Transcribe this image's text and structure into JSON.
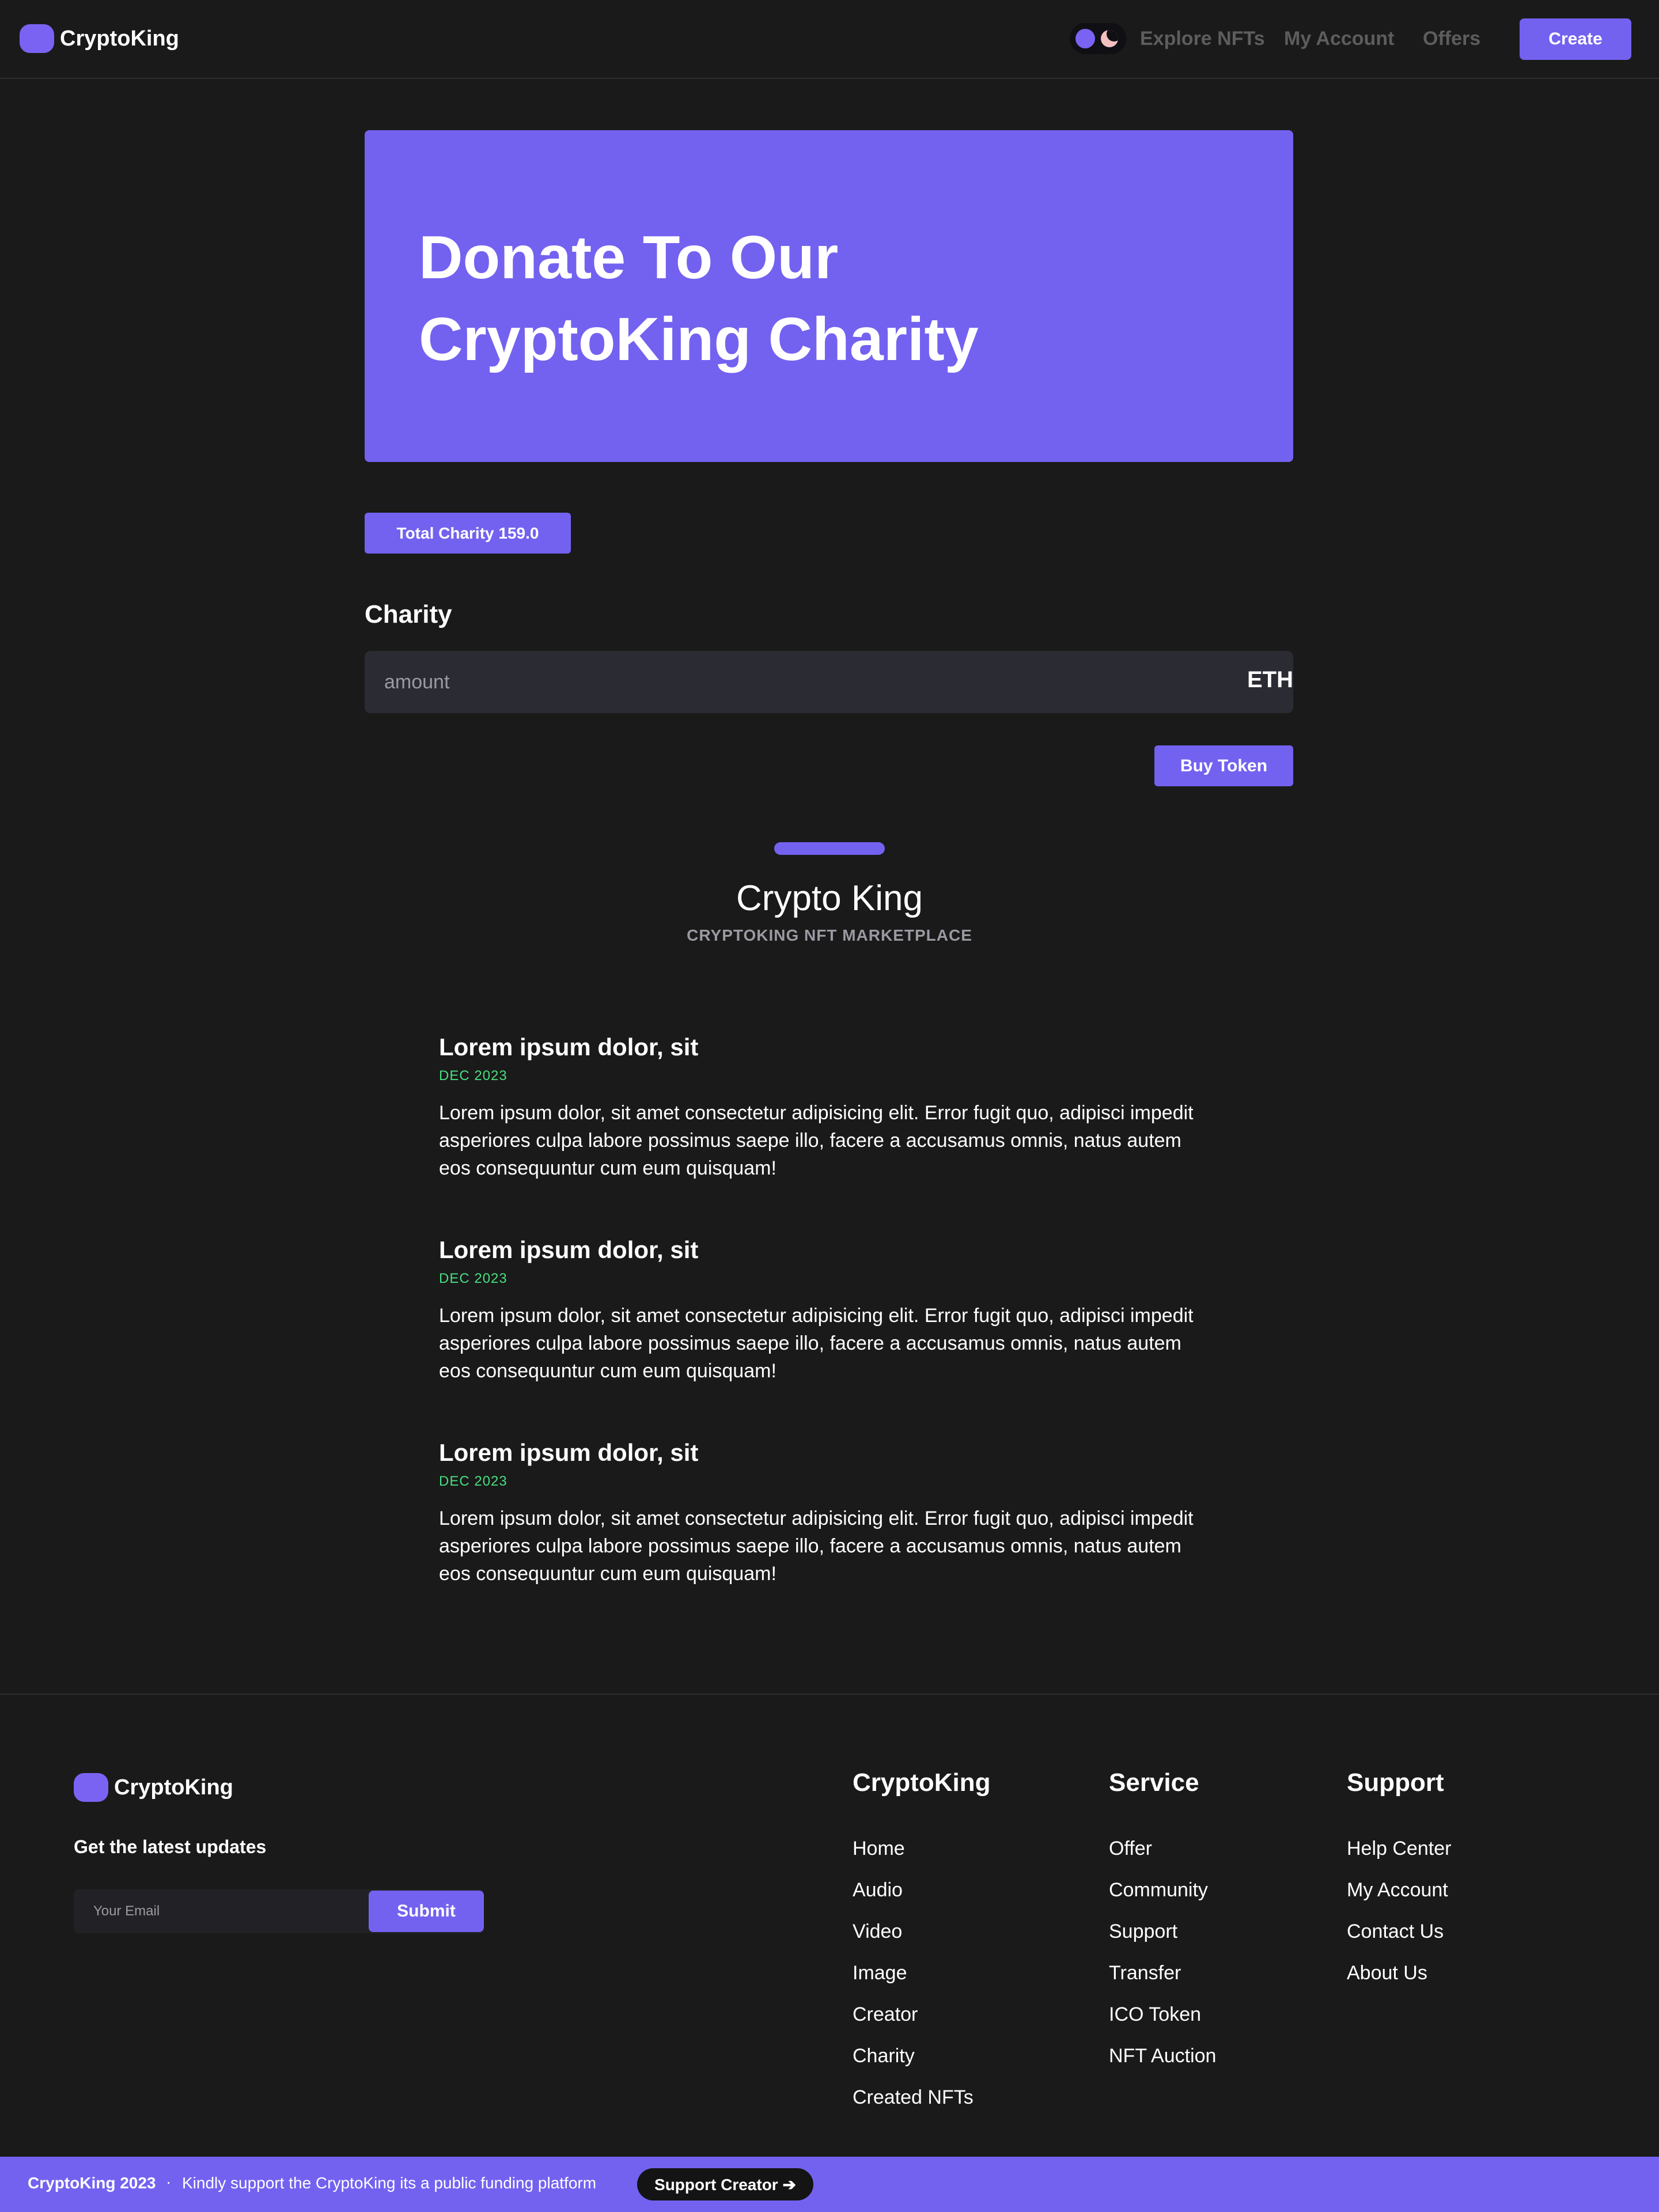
{
  "header": {
    "brand": "CryptoKing",
    "nav": [
      "Explore NFTs",
      "My Account",
      "Offers"
    ],
    "create_label": "Create"
  },
  "hero": {
    "title_line1": "Donate To Our",
    "title_line2": "CryptoKing Charity"
  },
  "charity": {
    "total_label": "Total Charity 159.0",
    "section_label": "Charity",
    "amount_placeholder": "amount",
    "currency": "ETH",
    "buy_label": "Buy Token"
  },
  "about": {
    "title": "Crypto King",
    "subtitle": "CRYPTOKING NFT MARKETPLACE"
  },
  "posts": [
    {
      "title": "Lorem ipsum dolor, sit",
      "date": "DEC 2023",
      "body": "Lorem ipsum dolor, sit amet consectetur adipisicing elit. Error fugit quo, adipisci impedit asperiores culpa labore possimus saepe illo, facere a accusamus omnis, natus autem eos consequuntur cum eum quisquam!"
    },
    {
      "title": "Lorem ipsum dolor, sit",
      "date": "DEC 2023",
      "body": "Lorem ipsum dolor, sit amet consectetur adipisicing elit. Error fugit quo, adipisci impedit asperiores culpa labore possimus saepe illo, facere a accusamus omnis, natus autem eos consequuntur cum eum quisquam!"
    },
    {
      "title": "Lorem ipsum dolor, sit",
      "date": "DEC 2023",
      "body": "Lorem ipsum dolor, sit amet consectetur adipisicing elit. Error fugit quo, adipisci impedit asperiores culpa labore possimus saepe illo, facere a accusamus omnis, natus autem eos consequuntur cum eum quisquam!"
    }
  ],
  "footer": {
    "brand": "CryptoKing",
    "tagline": "Get the latest updates",
    "email_placeholder": "Your Email",
    "submit_label": "Submit",
    "columns": [
      {
        "heading": "CryptoKing",
        "links": [
          "Home",
          "Audio",
          "Video",
          "Image",
          "Creator",
          "Charity",
          "Created NFTs"
        ]
      },
      {
        "heading": "Service",
        "links": [
          "Offer",
          "Community",
          "Support",
          "Transfer",
          "ICO Token",
          "NFT Auction"
        ]
      },
      {
        "heading": "Support",
        "links": [
          "Help Center",
          "My Account",
          "Contact Us",
          "About Us"
        ]
      }
    ]
  },
  "bottom_bar": {
    "brand": "CryptoKing 2023",
    "separator": "·",
    "text": "Kindly support the CryptoKing its a public funding platform",
    "button_label": "Support Creator ➔"
  },
  "icons": {
    "theme_toggle": "sun-moon-toggle-icon",
    "logo": "logo-pill-icon"
  },
  "colors": {
    "background": "#1a1a1a",
    "accent": "#7362f0",
    "date": "#4ade80",
    "muted": "#9a9aa3",
    "input_bg": "#2b2b33"
  }
}
